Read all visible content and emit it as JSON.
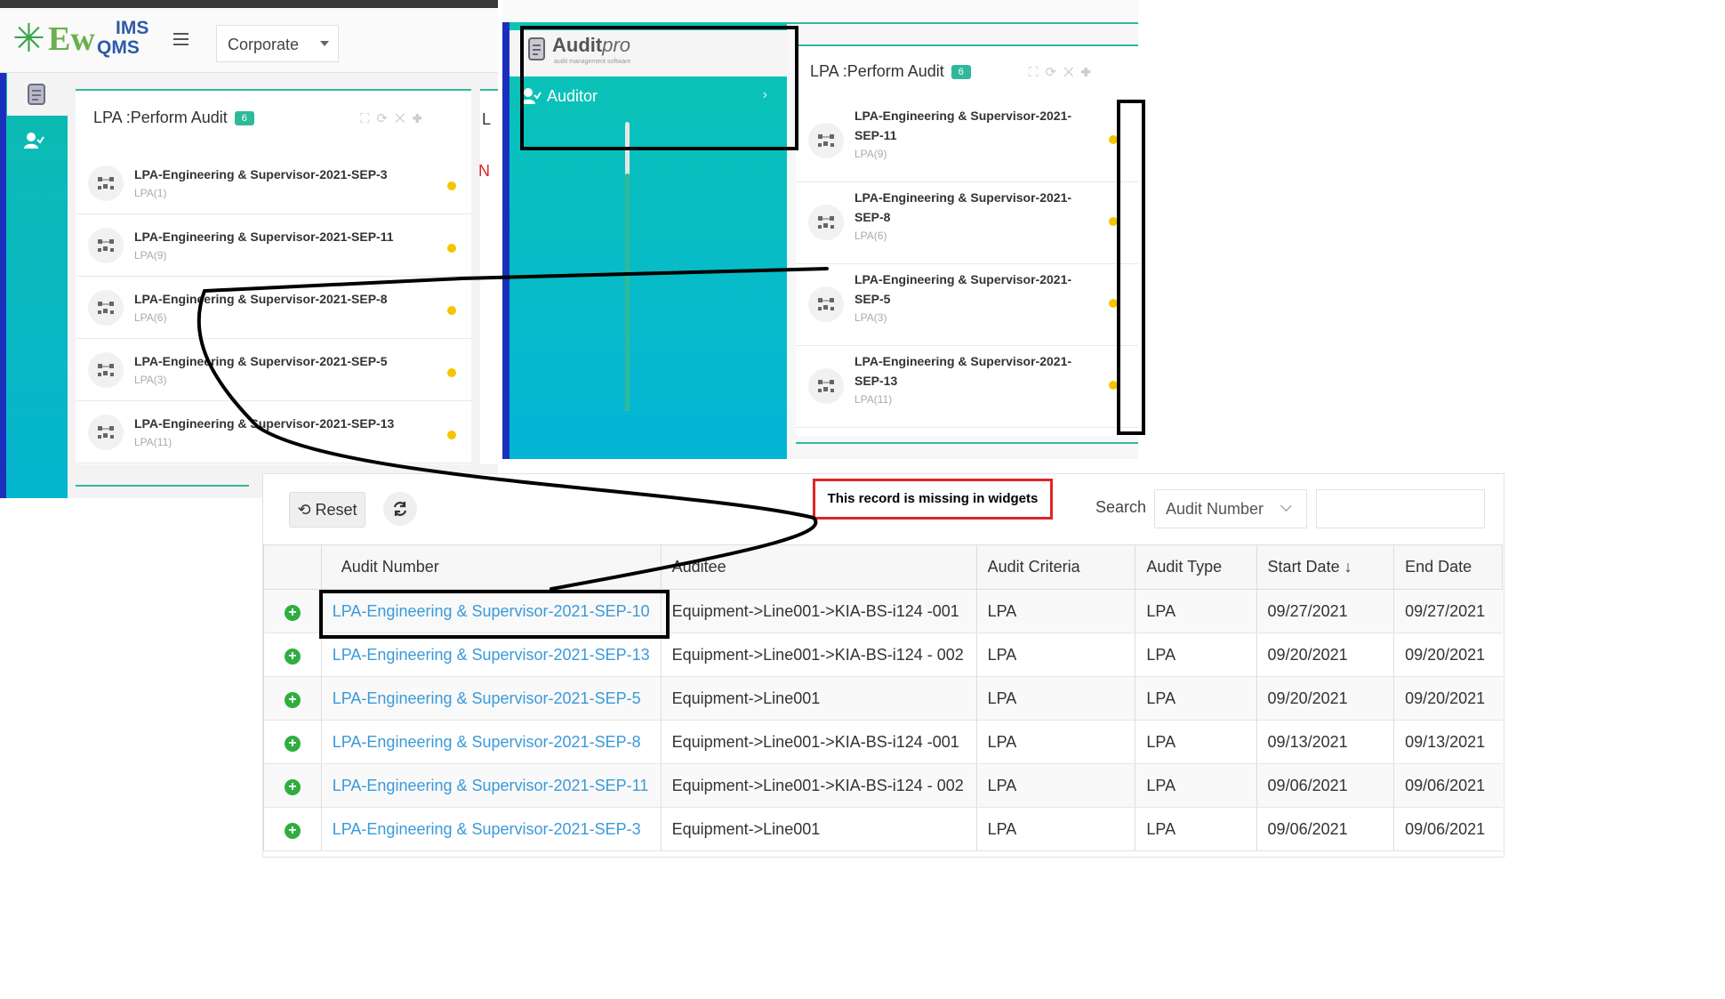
{
  "left_app": {
    "logo_main": "Ew",
    "logo_ims": "IMS",
    "logo_qms": "QMS",
    "org_select": "Corporate",
    "widget": {
      "title": "LPA :Perform Audit",
      "badge": "6",
      "items": [
        {
          "name": "LPA-Engineering & Supervisor-2021-SEP-3",
          "sub": "LPA(1)"
        },
        {
          "name": "LPA-Engineering & Supervisor-2021-SEP-11",
          "sub": "LPA(9)"
        },
        {
          "name": "LPA-Engineering & Supervisor-2021-SEP-8",
          "sub": "LPA(6)"
        },
        {
          "name": "LPA-Engineering & Supervisor-2021-SEP-5",
          "sub": "LPA(3)"
        },
        {
          "name": "LPA-Engineering & Supervisor-2021-SEP-13",
          "sub": "LPA(11)"
        }
      ]
    },
    "second_widget_initial": "L",
    "second_widget_red": "N"
  },
  "mid_app": {
    "logo_audit": "Audit",
    "logo_pro": "pro",
    "logo_tagline": "audit management software",
    "sidebar_item": "Auditor",
    "widget": {
      "title": "LPA :Perform Audit",
      "badge": "6",
      "items": [
        {
          "name1": "LPA-Engineering & Supervisor-2021-",
          "name2": "SEP-11",
          "sub": "LPA(9)"
        },
        {
          "name1": "LPA-Engineering & Supervisor-2021-",
          "name2": "SEP-8",
          "sub": "LPA(6)"
        },
        {
          "name1": "LPA-Engineering & Supervisor-2021-",
          "name2": "SEP-5",
          "sub": "LPA(3)"
        },
        {
          "name1": "LPA-Engineering & Supervisor-2021-",
          "name2": "SEP-13",
          "sub": "LPA(11)"
        }
      ]
    }
  },
  "grid": {
    "reset_label": "Reset",
    "note": "This record is missing in widgets",
    "search_label": "Search",
    "search_field": "Audit Number",
    "columns": [
      "Audit Number",
      "Auditee",
      "Audit Criteria",
      "Audit Type",
      "Start Date",
      "End Date"
    ],
    "sort_indicator": "↓",
    "rows": [
      {
        "audit_number": "LPA-Engineering & Supervisor-2021-SEP-10",
        "auditee": "Equipment->Line001->KIA-BS-i124 -001",
        "criteria": "LPA",
        "type": "LPA",
        "start": "09/27/2021",
        "end": "09/27/2021"
      },
      {
        "audit_number": "LPA-Engineering & Supervisor-2021-SEP-13",
        "auditee": "Equipment->Line001->KIA-BS-i124 - 002",
        "criteria": "LPA",
        "type": "LPA",
        "start": "09/20/2021",
        "end": "09/20/2021"
      },
      {
        "audit_number": "LPA-Engineering & Supervisor-2021-SEP-5",
        "auditee": "Equipment->Line001",
        "criteria": "LPA",
        "type": "LPA",
        "start": "09/20/2021",
        "end": "09/20/2021"
      },
      {
        "audit_number": "LPA-Engineering & Supervisor-2021-SEP-8",
        "auditee": "Equipment->Line001->KIA-BS-i124 -001",
        "criteria": "LPA",
        "type": "LPA",
        "start": "09/13/2021",
        "end": "09/13/2021"
      },
      {
        "audit_number": "LPA-Engineering & Supervisor-2021-SEP-11",
        "auditee": "Equipment->Line001->KIA-BS-i124 - 002",
        "criteria": "LPA",
        "type": "LPA",
        "start": "09/06/2021",
        "end": "09/06/2021"
      },
      {
        "audit_number": "LPA-Engineering & Supervisor-2021-SEP-3",
        "auditee": "Equipment->Line001",
        "criteria": "LPA",
        "type": "LPA",
        "start": "09/06/2021",
        "end": "09/06/2021"
      }
    ]
  },
  "colors": {
    "accent_teal": "#2fb99b",
    "sidebar_blue": "#1b2fbd",
    "link_blue": "#3a9ad9",
    "status_yellow": "#f5c400",
    "alert_red": "#e02424"
  }
}
